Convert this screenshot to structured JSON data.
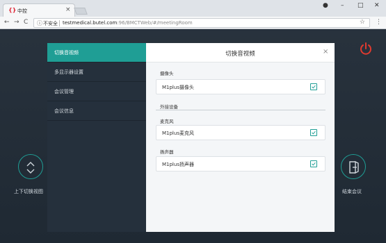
{
  "browser": {
    "tab_title": "中控",
    "tab_close": "×",
    "security_label": "不安全",
    "url_host": "testmedical.butel.com",
    "url_path": ":96/BMCTWeb/#/meetingRoom",
    "back": "←",
    "forward": "→",
    "reload": "C",
    "menu": "⋮",
    "star": "☆",
    "window_controls": {
      "account": "●",
      "minimize": "–",
      "maximize": "□",
      "close": "✕"
    }
  },
  "app": {
    "left_control_label": "上下切换视图",
    "right_control_label": "结束会议"
  },
  "sidebar": {
    "items": [
      {
        "label": "切换音视频",
        "active": true
      },
      {
        "label": "多显示器设置",
        "active": false
      },
      {
        "label": "会议管理",
        "active": false
      },
      {
        "label": "会议信息",
        "active": false
      }
    ]
  },
  "modal": {
    "title": "切换音视频",
    "close": "×",
    "sections": {
      "camera_label": "摄像头",
      "camera_value": "M1plus摄像头",
      "external_label": "外接设备",
      "mic_label": "麦克风",
      "mic_value": "M1plus麦克风",
      "speaker_label": "扬声器",
      "speaker_value": "M1plus扬声器"
    }
  },
  "colors": {
    "accent": "#1f9e95",
    "sidebar": "#25303c",
    "danger": "#e03a2f"
  }
}
